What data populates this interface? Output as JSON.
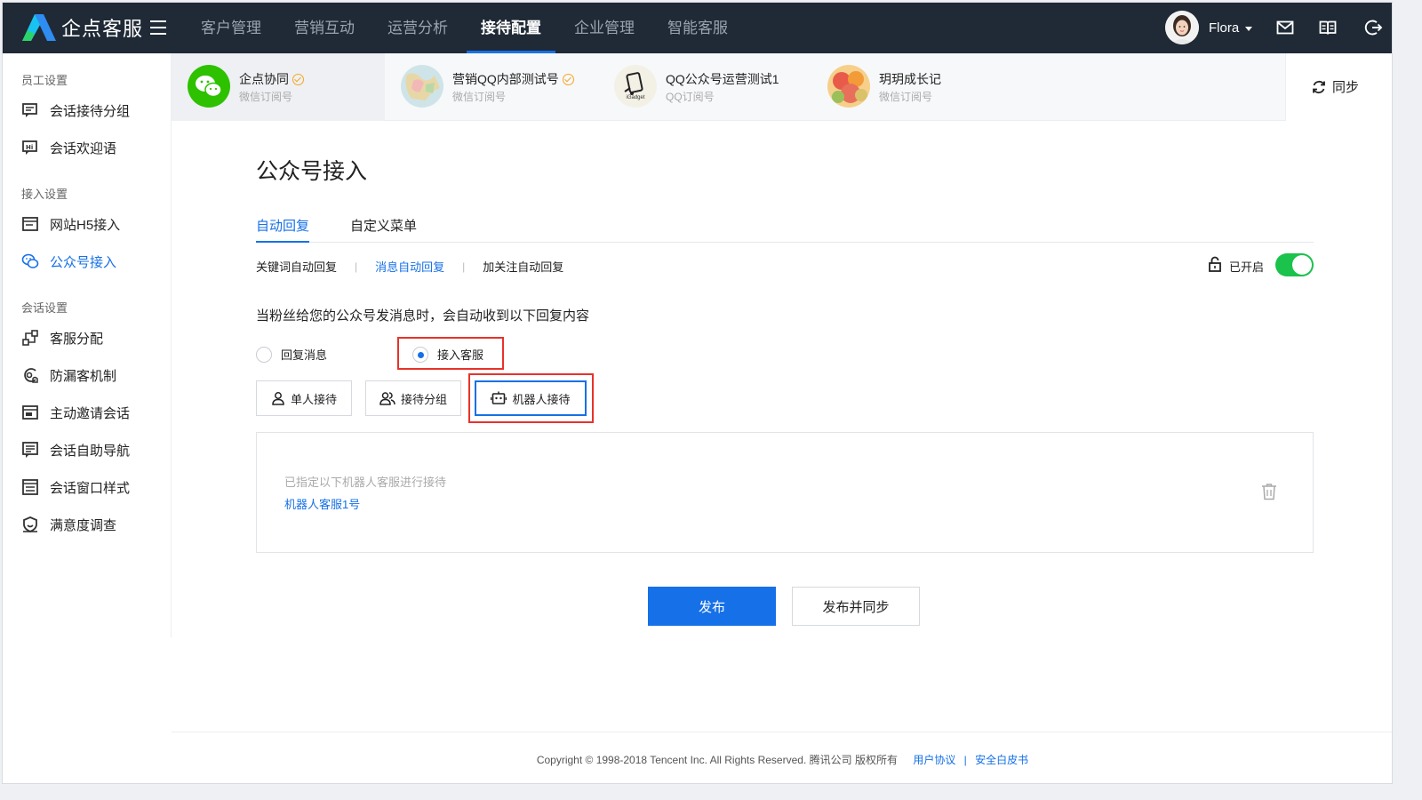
{
  "app": {
    "name": "企点客服"
  },
  "nav": [
    "客户管理",
    "营销互动",
    "运营分析",
    "接待配置",
    "企业管理",
    "智能客服"
  ],
  "nav_active": "接待配置",
  "user": {
    "name": "Flora"
  },
  "top_icons": [
    "mail-icon",
    "book-icon",
    "logout-icon"
  ],
  "sidebar": {
    "groups": [
      {
        "title": "员工设置",
        "items": [
          {
            "label": "会话接待分组",
            "icon": "chat-group-icon"
          },
          {
            "label": "会话欢迎语",
            "icon": "hi-bubble-icon"
          }
        ]
      },
      {
        "title": "接入设置",
        "items": [
          {
            "label": "网站H5接入",
            "icon": "web-icon"
          },
          {
            "label": "公众号接入",
            "icon": "public-account-icon",
            "active": true
          }
        ]
      },
      {
        "title": "会话设置",
        "items": [
          {
            "label": "客服分配",
            "icon": "distribution-icon"
          },
          {
            "label": "防漏客机制",
            "icon": "anti-leak-icon"
          },
          {
            "label": "主动邀请会话",
            "icon": "invite-icon"
          },
          {
            "label": "会话自助导航",
            "icon": "navigation-icon"
          },
          {
            "label": "会话窗口样式",
            "icon": "window-style-icon"
          },
          {
            "label": "满意度调查",
            "icon": "satisfaction-icon"
          }
        ]
      }
    ]
  },
  "accounts": [
    {
      "name": "企点协同",
      "type": "微信订阅号",
      "verified": true,
      "active": true
    },
    {
      "name": "营销QQ内部测试号",
      "type": "微信订阅号",
      "verified": true
    },
    {
      "name": "QQ公众号运营测试1",
      "type": "QQ订阅号",
      "verified": false,
      "avatar_text": "iGadget"
    },
    {
      "name": "玥玥成长记",
      "type": "微信订阅号",
      "verified": false
    }
  ],
  "sync_label": "同步",
  "page_title": "公众号接入",
  "tabs": [
    "自动回复",
    "自定义菜单"
  ],
  "subtabs": [
    "关键词自动回复",
    "消息自动回复",
    "加关注自动回复"
  ],
  "subtab_active": "消息自动回复",
  "status_label": "已开启",
  "toggle_on": true,
  "description": "当粉丝给您的公众号发消息时，会自动收到以下回复内容",
  "radio_options": [
    {
      "label": "回复消息",
      "checked": false
    },
    {
      "label": "接入客服",
      "checked": true
    }
  ],
  "modes": [
    {
      "label": "单人接待",
      "icon": "person-icon"
    },
    {
      "label": "接待分组",
      "icon": "group-icon"
    },
    {
      "label": "机器人接待",
      "icon": "robot-icon",
      "active": true
    }
  ],
  "robot_panel": {
    "hint": "已指定以下机器人客服进行接待",
    "robot_name": "机器人客服1号"
  },
  "buttons": {
    "publish": "发布",
    "publish_sync": "发布并同步"
  },
  "footer": {
    "copyright": "Copyright © 1998-2018 Tencent Inc. All Rights Reserved. 腾讯公司 版权所有",
    "links": [
      "用户协议",
      "安全白皮书"
    ],
    "link_separator": "|"
  },
  "colors": {
    "topbar": "#1f2a36",
    "accent": "#1670e8",
    "toggle": "#1bc24b",
    "highlight": "#e8322a"
  }
}
